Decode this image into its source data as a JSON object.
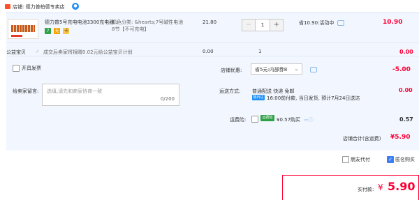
{
  "shop": {
    "label": "店铺: 德力普柏德专卖店",
    "ww_icon": "wangwang-chat-icon"
  },
  "item": {
    "title": "德力普5号充电电池3300充电器...",
    "spec_line1": "颜色分类: &hearts;7号碱性电池",
    "spec_line2": "8节【不可充电】",
    "unit_price": "21.80",
    "qty_minus": "−",
    "qty": "1",
    "qty_plus": "+",
    "promo": "省10.90:活动中",
    "line_total": "10.90",
    "badges": [
      "7",
      "无",
      "卡"
    ]
  },
  "charity": {
    "label": "公益宝贝",
    "check": "✓",
    "text": "成交后卖家将捐赠0.02元给公益宝贝计划",
    "price": "0.00",
    "qty": "1",
    "total": "0.00"
  },
  "invoice": {
    "label": "开具发票"
  },
  "shop_discount": {
    "label": "店铺优惠:",
    "selected": "省5元:内部券8",
    "total": "-5.00"
  },
  "message": {
    "label": "给卖家留言:",
    "placeholder": "选填,请先和商家协商一致",
    "count": "0/200"
  },
  "shipping": {
    "label": "运送方式:",
    "method": "普通配送 快递 免邮",
    "badge": "隔日达",
    "date": "16:00前付款, 当日发货, 预计7月24日送达",
    "total": "0.00"
  },
  "insurance": {
    "label": "运费险:",
    "badge": "运费险",
    "text": "¥0.57购买",
    "total": "0.57"
  },
  "store_total": {
    "label": "店铺合计(含运费)",
    "value": "¥5.90"
  },
  "options": {
    "friend_pay": "朋友代付",
    "anonymous": "匿名购买"
  },
  "payment": {
    "label": "实付款:",
    "currency": "¥",
    "amount": "5.90"
  },
  "colors": {
    "accent_red": "#ff0036",
    "panel_bg": "#f2f7ff",
    "link_blue": "#1f8ff5"
  }
}
